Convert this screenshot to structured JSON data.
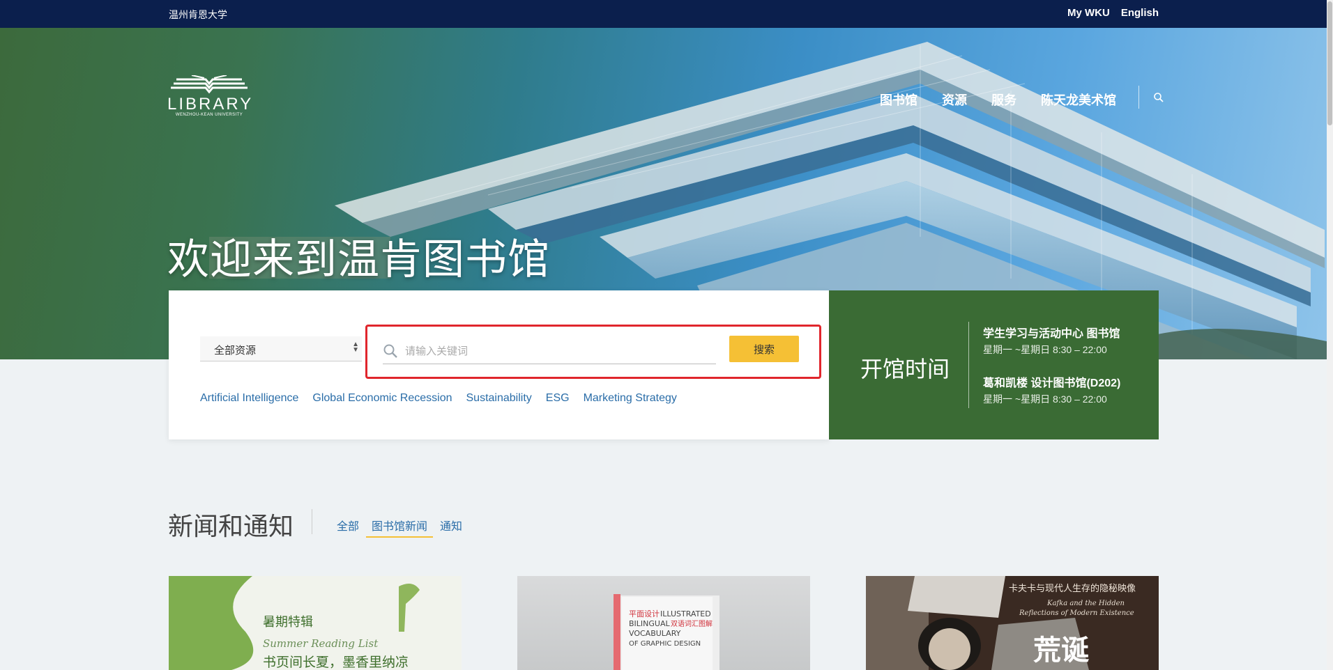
{
  "topbar": {
    "university": "温州肯恩大学",
    "my_wku": "My WKU",
    "english": "English"
  },
  "logo": {
    "word": "LIBRARY",
    "subtitle": "WENZHOU-KEAN UNIVERSITY"
  },
  "nav": {
    "items": [
      "图书馆",
      "资源",
      "服务",
      "陈天龙美术馆"
    ],
    "search_icon": "search-icon"
  },
  "hero": {
    "welcome": "欢迎来到温肯图书馆"
  },
  "search": {
    "select_value": "全部资源",
    "placeholder": "请输入关键词",
    "button": "搜索",
    "tags": [
      "Artificial Intelligence",
      "Global Economic Recession",
      "Sustainability",
      "ESG",
      "Marketing Strategy"
    ]
  },
  "hours": {
    "title": "开馆时间",
    "locations": [
      {
        "name": "学生学习与活动中心 图书馆",
        "time": "星期一 ~星期日 8:30 – 22:00"
      },
      {
        "name": "葛和凯楼 设计图书馆(D202)",
        "time": "星期一 ~星期日 8:30 – 22:00"
      }
    ]
  },
  "news": {
    "title": "新闻和通知",
    "tabs": [
      "全部",
      "图书馆新闻",
      "通知"
    ],
    "active_tab": "图书馆新闻",
    "cards": [
      {
        "line1": "暑期特辑",
        "line2": "Summer Reading List",
        "line3": "书页间长夏，墨香里纳凉"
      },
      {
        "line1": "平面设计",
        "line2": "ILLUSTRATED",
        "line3": "BILINGUAL",
        "line4": "VOCABULARY",
        "line5": "OF GRAPHIC DESIGN",
        "cn": "双语词汇图解"
      },
      {
        "line1": "卡夫卡与现代人生存的隐秘映像",
        "line2": "Kafka and the Hidden",
        "line3": "Reflections of Modern Existence",
        "line4": "荒诞"
      }
    ]
  },
  "colors": {
    "topbar": "#0b1f4d",
    "hours_bg": "#3a6b34",
    "button": "#f5c035",
    "link": "#2a6da8",
    "highlight": "#e0262c"
  }
}
